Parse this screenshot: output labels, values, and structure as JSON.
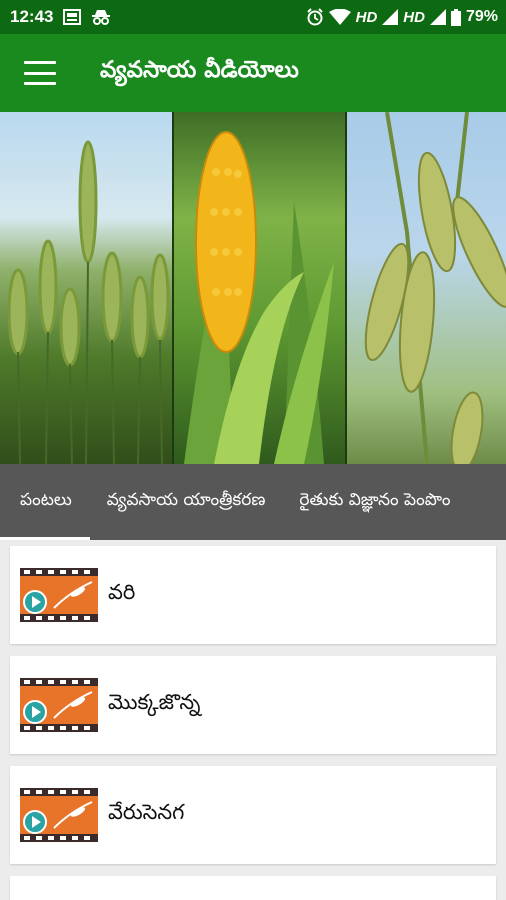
{
  "status_bar": {
    "time": "12:43",
    "network_1": "HD",
    "network_2": "HD",
    "battery": "79%"
  },
  "app_bar": {
    "title": "వ్యవసాయ వీడియోలు",
    "menu_icon": "hamburger-menu-icon"
  },
  "banner": {
    "panels": [
      "wheat",
      "corn",
      "soybean"
    ]
  },
  "tabs": [
    {
      "label": "పంటలు",
      "active": true
    },
    {
      "label": "వ్యవసాయ యాంత్రీకరణ",
      "active": false
    },
    {
      "label": "రైతుకు విజ్ఞానం పెంపొం",
      "active": false
    }
  ],
  "list": {
    "items": [
      {
        "label": "వరి",
        "icon": "video-play-icon"
      },
      {
        "label": "మొక్కజొన్న",
        "icon": "video-play-icon"
      },
      {
        "label": "వేరుసెనగ",
        "icon": "video-play-icon"
      }
    ]
  },
  "colors": {
    "status_bar": "#0e6a12",
    "app_bar": "#1a8a1f",
    "tab_bar": "#575757",
    "play_button": "#29a3a3",
    "film_strip": "#e8742a"
  }
}
